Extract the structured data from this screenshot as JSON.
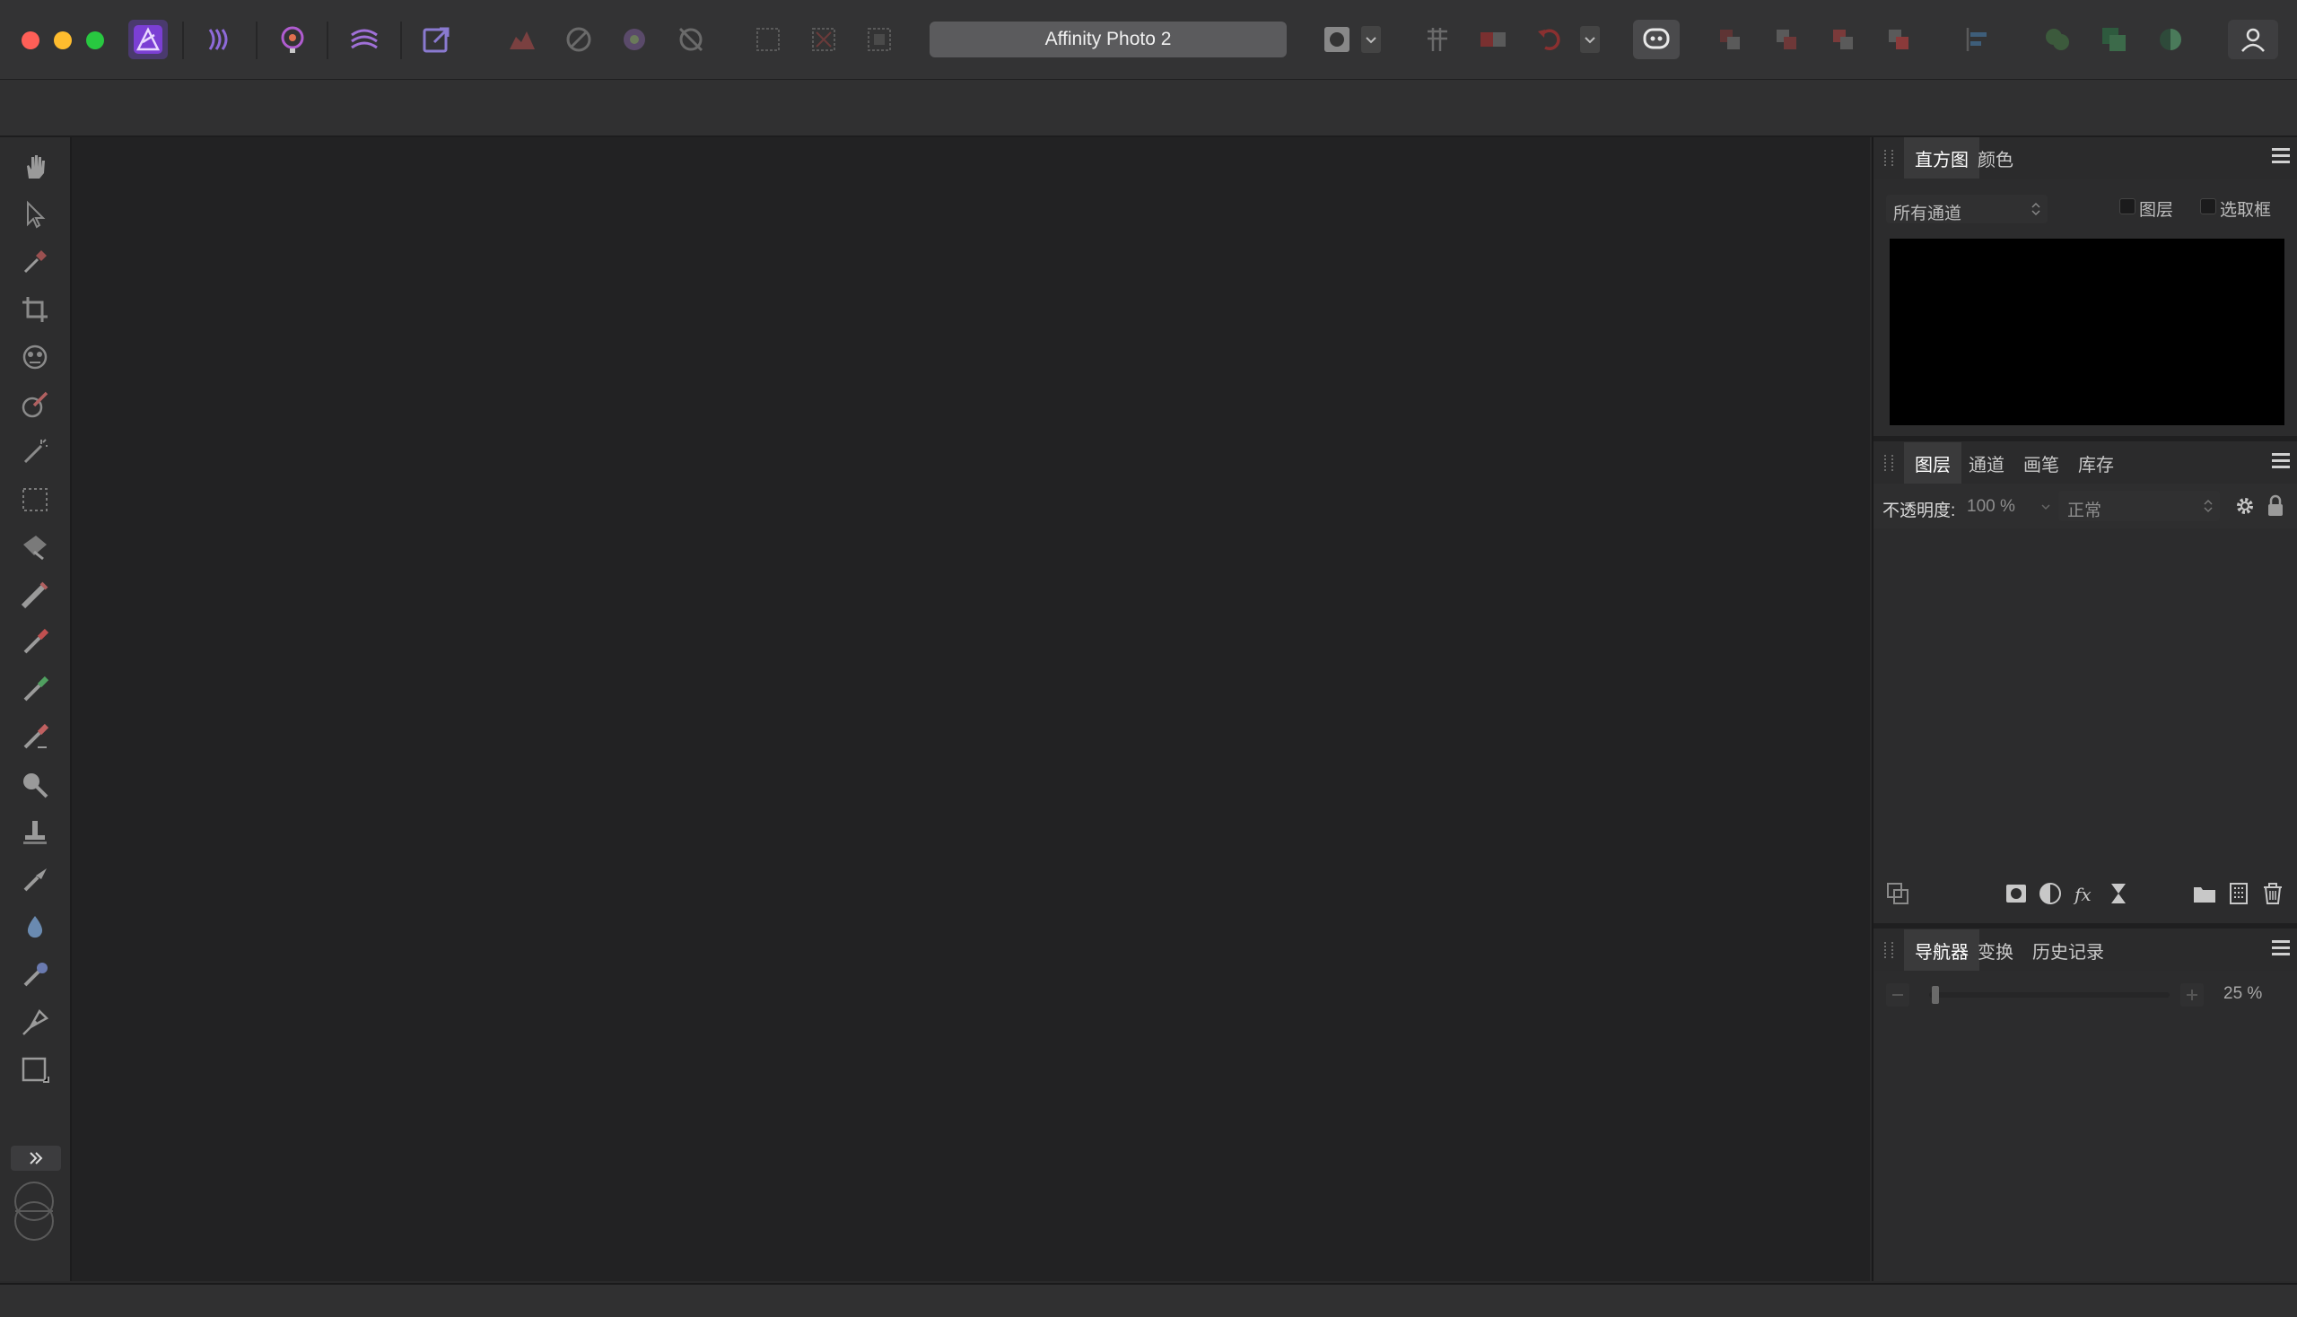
{
  "window": {
    "title": "Affinity Photo 2"
  },
  "colors": {
    "accent": "#7b3fd4",
    "traffic_close": "#ff5f57",
    "traffic_min": "#febc2e",
    "traffic_max": "#28c840"
  },
  "personas": [
    "photo-persona-icon",
    "liquify-persona-icon",
    "develop-persona-icon",
    "tone-mapping-persona-icon",
    "export-persona-icon"
  ],
  "tools": [
    "hand-tool-icon",
    "move-tool-icon",
    "color-picker-icon",
    "crop-tool-icon",
    "mesh-warp-icon",
    "paint-mixer-icon",
    "flood-select-icon",
    "marquee-tool-icon",
    "selection-brush-icon",
    "brush-tool-icon",
    "paint-brush-icon",
    "pixel-brush-icon",
    "erase-brush-icon",
    "dodge-tool-icon",
    "clone-tool-icon",
    "healing-brush-icon",
    "blur-brush-icon",
    "smudge-brush-icon",
    "pen-tool-icon",
    "rectangle-tool-icon"
  ],
  "histogram_panel": {
    "tabs": [
      "直方图",
      "颜色"
    ],
    "channel_select": "所有通道",
    "check_layer": "图层",
    "check_selection": "选取框"
  },
  "layers_panel": {
    "tabs": [
      "图层",
      "通道",
      "画笔",
      "库存"
    ],
    "opacity_label": "不透明度:",
    "opacity_value": "100 %",
    "blend_mode": "正常"
  },
  "navigator_panel": {
    "tabs": [
      "导航器",
      "变换",
      "历史记录"
    ],
    "zoom_value": "25 %",
    "zoom_level": 0.25
  }
}
